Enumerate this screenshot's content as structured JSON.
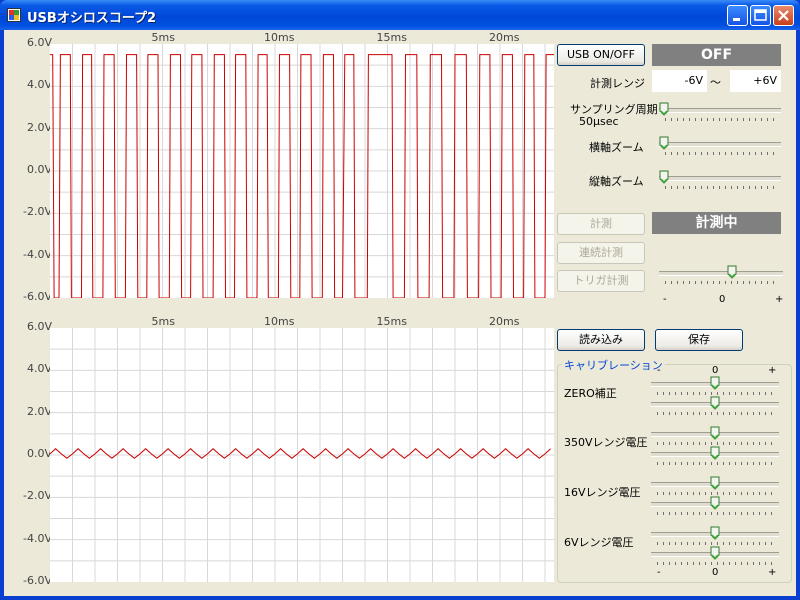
{
  "window": {
    "title": "USBオシロスコープ2",
    "colors": {
      "titlebar": "#0054e3",
      "client": "#ece9d8",
      "waveform": "#cc0000",
      "status_bg": "#808080"
    }
  },
  "plot_top": {
    "y_ticks": [
      "6.0V",
      "4.0V",
      "2.0V",
      "0.0V",
      "-2.0V",
      "-4.0V",
      "-6.0V"
    ],
    "x_ticks": [
      "5ms",
      "10ms",
      "15ms",
      "20ms"
    ]
  },
  "plot_bottom": {
    "y_ticks": [
      "6.0V",
      "4.0V",
      "2.0V",
      "0.0V",
      "-2.0V",
      "-4.0V",
      "-6.0V"
    ],
    "x_ticks": [
      "5ms",
      "10ms",
      "15ms",
      "20ms"
    ]
  },
  "controls": {
    "usb_button": "USB ON/OFF",
    "usb_status": "OFF",
    "range_label": "計測レンジ",
    "range_min": "-6V",
    "range_sep": "～",
    "range_max": "+6V",
    "sampling_label": "サンプリング周期",
    "sampling_value": "50μsec",
    "hzoom_label": "横軸ズーム",
    "vzoom_label": "縦軸ズーム",
    "measure_button": "計測",
    "measure_status": "計測中",
    "continuous_button": "連続計測",
    "trigger_button": "トリガ計測",
    "trigger_minus": "-",
    "trigger_zero": "0",
    "trigger_plus": "+",
    "load_button": "読み込み",
    "save_button": "保存"
  },
  "calibration": {
    "title": "キャリブレーション",
    "scale_minus": "-",
    "scale_zero": "0",
    "scale_plus": "+",
    "rows": [
      {
        "label": "ZERO補正"
      },
      {
        "label": "350Vレンジ電圧"
      },
      {
        "label": "16Vレンジ電圧"
      },
      {
        "label": "6Vレンジ電圧"
      }
    ]
  },
  "chart_data": [
    {
      "type": "line",
      "title": "",
      "xlabel": "",
      "ylabel": "",
      "xlim": [
        0,
        22.4
      ],
      "ylim": [
        -6,
        6
      ],
      "x_ticks": [
        5,
        10,
        15,
        20
      ],
      "y_ticks": [
        6,
        4,
        2,
        0,
        -2,
        -4,
        -6
      ],
      "grid": true,
      "series": [
        {
          "description_shape": "square",
          "x": [
            0,
            0.12,
            0.18,
            0.4,
            0.46,
            0.9,
            0.95,
            1.4,
            1.45,
            1.85,
            1.9,
            2.35,
            2.4,
            2.85,
            2.9,
            3.35,
            3.4,
            3.85,
            3.9,
            4.3,
            4.35,
            4.8,
            4.85,
            5.3,
            5.35,
            5.8,
            5.85,
            6.25,
            6.3,
            6.75,
            6.8,
            7.25,
            7.3,
            7.75,
            7.8,
            8.2,
            8.25,
            8.7,
            8.75,
            9.2,
            9.25,
            9.65,
            9.7,
            10.15,
            10.2,
            10.65,
            10.7,
            11.1,
            11.15,
            11.6,
            11.65,
            12.1,
            12.15,
            12.6,
            12.65,
            13.0,
            13.1,
            13.5,
            13.55,
            14.1,
            14.15,
            15.2,
            15.25,
            15.75,
            15.8,
            16.3,
            16.35,
            16.85,
            16.9,
            17.4,
            17.45,
            17.95,
            18.0,
            18.5,
            18.55,
            19.05,
            19.1,
            19.55,
            19.6,
            20.05,
            20.1,
            20.55,
            20.6,
            21.05,
            21.1,
            21.5,
            21.55,
            22.0,
            22.05,
            22.4
          ],
          "values": [
            5.5,
            5.5,
            -6,
            -6,
            5.5,
            5.5,
            -6,
            -6,
            5.5,
            5.5,
            -6,
            -6,
            5.5,
            5.5,
            -6,
            -6,
            5.5,
            5.5,
            -6,
            -6,
            5.5,
            5.5,
            -6,
            -6,
            5.5,
            5.5,
            -6,
            -6,
            5.5,
            5.5,
            -6,
            -6,
            5.5,
            5.5,
            -6,
            -6,
            5.5,
            5.5,
            -6,
            -6,
            5.5,
            5.5,
            -6,
            -6,
            5.5,
            5.5,
            -6,
            -6,
            5.5,
            5.5,
            -6,
            -6,
            5.5,
            5.5,
            -6,
            -6,
            5.5,
            5.5,
            -6,
            -6,
            5.5,
            5.5,
            -6,
            -6,
            5.5,
            5.5,
            -6,
            -6,
            5.5,
            5.5,
            -6,
            -6,
            5.5,
            5.5,
            -6,
            -6,
            5.5,
            5.5,
            -6,
            -6,
            5.5,
            5.5,
            -6,
            -6,
            5.5,
            5.5,
            -6,
            -6,
            5.5,
            5.5
          ]
        }
      ]
    },
    {
      "type": "line",
      "title": "",
      "xlabel": "",
      "ylabel": "",
      "xlim": [
        0,
        22.4
      ],
      "ylim": [
        -6,
        6
      ],
      "x_ticks": [
        5,
        10,
        15,
        20
      ],
      "y_ticks": [
        6,
        4,
        2,
        0,
        -2,
        -4,
        -6
      ],
      "grid": true,
      "series": [
        {
          "x": [
            0,
            0.25,
            0.5,
            0.75,
            1.0,
            1.25,
            1.5,
            1.75,
            2.0,
            2.25,
            2.5,
            2.75,
            3.0,
            3.25,
            3.5,
            3.75,
            4.0,
            4.25,
            4.5,
            4.75,
            5.0,
            5.25,
            5.5,
            5.75,
            6.0,
            6.25,
            6.5,
            6.75,
            7.0,
            7.25,
            7.5,
            7.75,
            8.0,
            8.25,
            8.5,
            8.75,
            9.0,
            9.25,
            9.5,
            9.75,
            10.0,
            10.25,
            10.5,
            10.75,
            11.0,
            11.25,
            11.5,
            11.75,
            12.0,
            12.25,
            12.5,
            12.75,
            13.0,
            13.25,
            13.5,
            13.75,
            14.0,
            14.25,
            14.5,
            14.75,
            15.0,
            15.25,
            15.5,
            15.75,
            16.0,
            16.25,
            16.5,
            16.75,
            17.0,
            17.25,
            17.5,
            17.75,
            18.0,
            18.25,
            18.5,
            18.75,
            19.0,
            19.25,
            19.5,
            19.75,
            20.0,
            20.25,
            20.5,
            20.75,
            21.0,
            21.25,
            21.5,
            21.75,
            22.0,
            22.25
          ],
          "values": [
            0.05,
            0.3,
            0.05,
            -0.15,
            0.05,
            0.3,
            0.05,
            -0.15,
            0.05,
            0.3,
            0.05,
            -0.15,
            0.05,
            0.3,
            0.05,
            -0.15,
            0.05,
            0.3,
            0.05,
            -0.15,
            0.05,
            0.3,
            0.05,
            -0.15,
            0.05,
            0.3,
            0.05,
            -0.15,
            0.05,
            0.3,
            0.05,
            -0.15,
            0.05,
            0.3,
            0.05,
            -0.15,
            0.05,
            0.3,
            0.05,
            -0.15,
            0.05,
            0.3,
            0.05,
            -0.15,
            0.05,
            0.3,
            0.05,
            -0.15,
            0.05,
            0.3,
            0.05,
            -0.15,
            0.05,
            0.3,
            0.05,
            -0.15,
            0.05,
            0.3,
            0.05,
            -0.15,
            0.05,
            0.3,
            0.05,
            -0.15,
            0.05,
            0.3,
            0.05,
            -0.15,
            0.05,
            0.3,
            0.05,
            -0.15,
            0.05,
            0.3,
            0.05,
            -0.15,
            0.05,
            0.3,
            0.05,
            -0.15,
            0.05,
            0.3,
            0.05,
            -0.15,
            0.05,
            0.3,
            0.05,
            -0.15,
            0.05,
            0.3
          ]
        }
      ]
    }
  ],
  "sliders": {
    "sampling": 0,
    "hzoom": 0,
    "vzoom": 0,
    "trigger": 0.6,
    "calibration": [
      [
        0.5,
        0.5
      ],
      [
        0.5,
        0.5
      ],
      [
        0.5,
        0.5
      ],
      [
        0.5,
        0.5
      ]
    ]
  }
}
